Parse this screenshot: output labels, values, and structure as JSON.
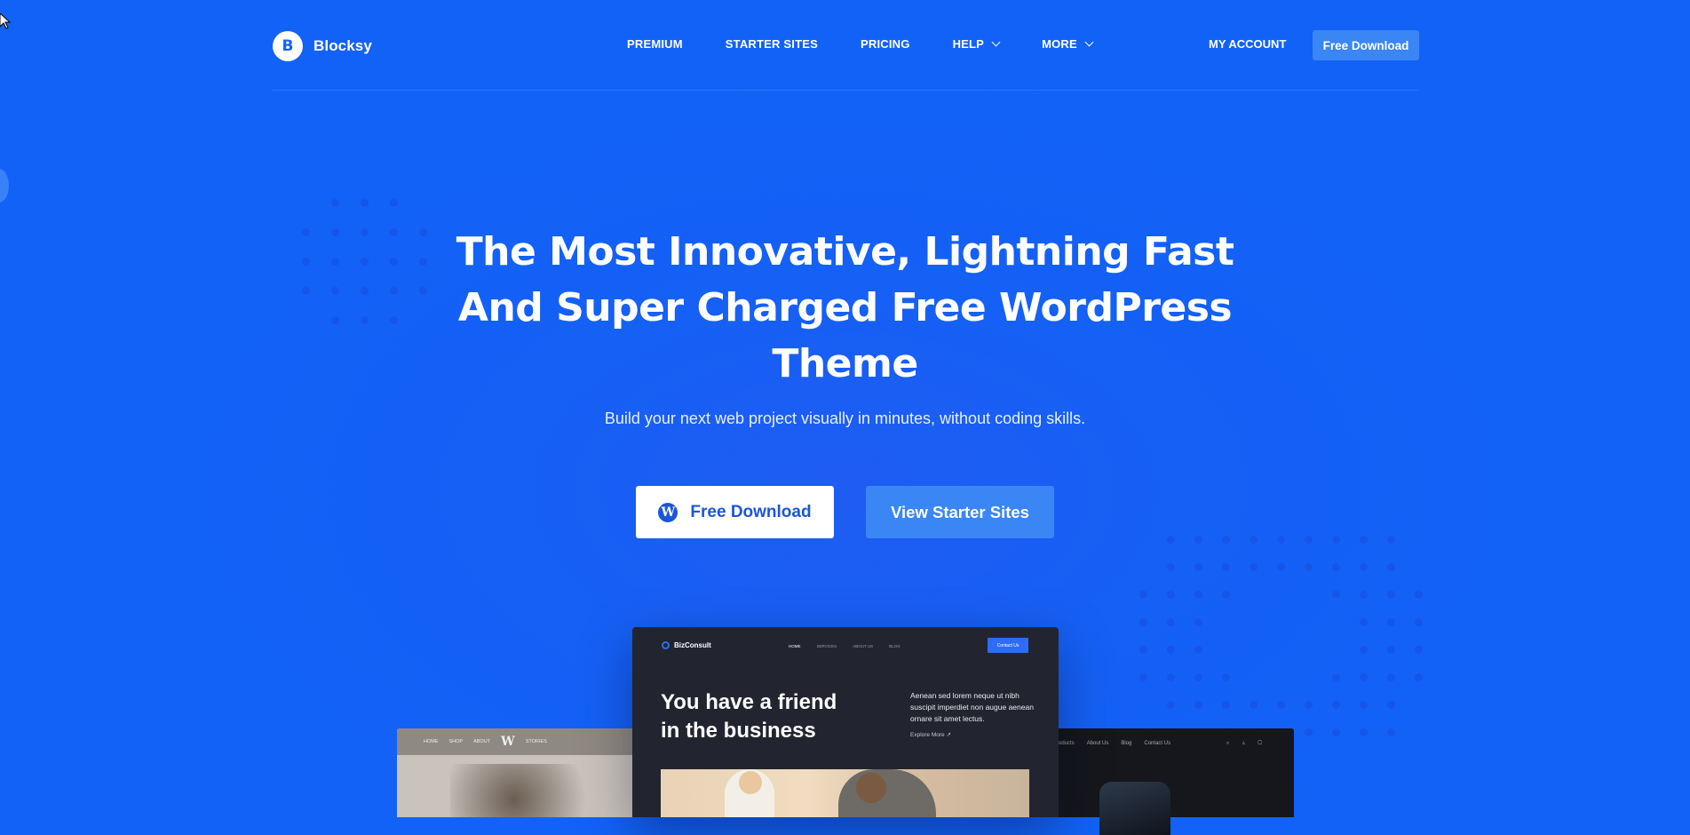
{
  "brand": {
    "name": "Blocksy",
    "mark": "B"
  },
  "nav": {
    "items": [
      {
        "label": "PREMIUM",
        "has_dropdown": false
      },
      {
        "label": "STARTER SITES",
        "has_dropdown": false
      },
      {
        "label": "PRICING",
        "has_dropdown": false
      },
      {
        "label": "HELP",
        "has_dropdown": true
      },
      {
        "label": "MORE",
        "has_dropdown": true
      }
    ],
    "account_label": "MY ACCOUNT",
    "cta_label": "Free Download"
  },
  "hero": {
    "title_lines": [
      "The Most Innovative, Lightning Fast",
      "And Super Charged Free WordPress",
      "Theme"
    ],
    "subtitle": "Build your next web project visually in minutes, without coding skills.",
    "primary_button": "Free Download",
    "secondary_button": "View Starter Sites"
  },
  "preview_center": {
    "logo": "BizConsult",
    "nav": [
      "HOME",
      "SERVICES",
      "ABOUT US",
      "BLOG"
    ],
    "cta": "Contact Us",
    "headline_lines": [
      "You have a friend",
      "in the business"
    ],
    "paragraph": "Aenean sed lorem neque ut nibh suscipit imperdiet non augue aenean ornare sit amet lectus.",
    "link": "Explore More ↗"
  },
  "preview_left": {
    "nav": [
      "HOME",
      "SHOP",
      "ABOUT",
      "STORIES"
    ],
    "logo": "W"
  },
  "preview_right": {
    "nav": [
      "Products",
      "About Us",
      "Blog",
      "Contact Us"
    ]
  },
  "colors": {
    "background": "#1461f6",
    "accent_button": "#3a86f5",
    "white": "#ffffff",
    "primary_text_on_white": "#1d55d9"
  }
}
